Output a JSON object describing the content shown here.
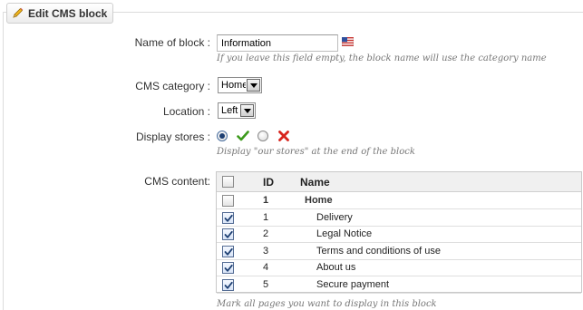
{
  "legend": {
    "title": "Edit CMS block",
    "icon": "pencil-icon"
  },
  "fields": {
    "name": {
      "label": "Name of block :",
      "value": "Information",
      "hint": "If you leave this field empty, the block name will use the category name",
      "flag_icon": "us-flag-icon"
    },
    "category": {
      "label": "CMS category :",
      "value": "Home"
    },
    "location": {
      "label": "Location :",
      "value": "Left"
    },
    "stores": {
      "label": "Display stores :",
      "selected": "yes",
      "hint": "Display \"our stores\" at the end of the block",
      "yes_icon": "check-icon",
      "no_icon": "cross-icon",
      "yes_color": "#3c9a1b",
      "no_color": "#d8241c"
    }
  },
  "cms_content": {
    "label": "CMS content:",
    "columns": {
      "id": "ID",
      "name": "Name"
    },
    "rows": [
      {
        "id": "1",
        "name": "Home",
        "type": "category",
        "checked": false
      },
      {
        "id": "1",
        "name": "Delivery",
        "type": "page",
        "checked": true
      },
      {
        "id": "2",
        "name": "Legal Notice",
        "type": "page",
        "checked": true
      },
      {
        "id": "3",
        "name": "Terms and conditions of use",
        "type": "page",
        "checked": true
      },
      {
        "id": "4",
        "name": "About us",
        "type": "page",
        "checked": true
      },
      {
        "id": "5",
        "name": "Secure payment",
        "type": "page",
        "checked": true
      }
    ],
    "hint": "Mark all pages you want to display in this block"
  }
}
